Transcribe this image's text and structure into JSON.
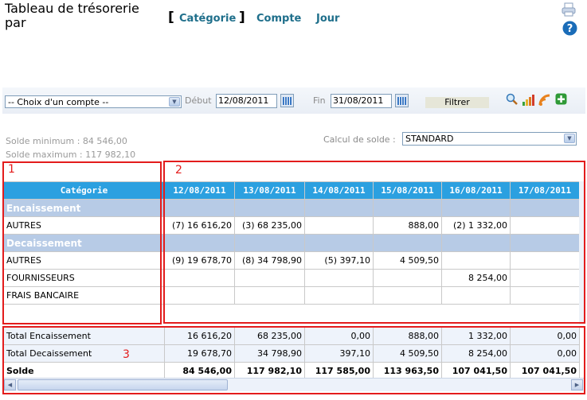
{
  "header": {
    "title_line1": "Tableau de trésorerie",
    "title_line2": "par",
    "bracket_open": "[",
    "bracket_close": "]",
    "nav": [
      "Catégorie",
      "Compte",
      "Jour"
    ]
  },
  "toolbar": {
    "account_select": "-- Choix d'un compte --",
    "debut_label": "Début",
    "debut_value": "12/08/2011",
    "fin_label": "Fin",
    "fin_value": "31/08/2011",
    "filter_label": "Filtrer"
  },
  "summary": {
    "min": "Solde minimum : 84 546,00",
    "max": "Solde maximum : 117 982,10",
    "calc_label": "Calcul de solde :",
    "calc_value": "STANDARD"
  },
  "table": {
    "category_header": "Catégorie",
    "dates": [
      "12/08/2011",
      "13/08/2011",
      "14/08/2011",
      "15/08/2011",
      "16/08/2011",
      "17/08/2011"
    ],
    "rows": [
      {
        "type": "section",
        "label": "Encaissement",
        "cells": [
          "",
          "",
          "",
          "",
          "",
          ""
        ]
      },
      {
        "type": "data",
        "label": "AUTRES",
        "cells": [
          "(7) 16 616,20",
          "(3) 68 235,00",
          "",
          "888,00",
          "(2) 1 332,00",
          ""
        ]
      },
      {
        "type": "section",
        "label": "Decaissement",
        "cells": [
          "",
          "",
          "",
          "",
          "",
          ""
        ]
      },
      {
        "type": "data",
        "label": "AUTRES",
        "cells": [
          "(9) 19 678,70",
          "(8) 34 798,90",
          "(5) 397,10",
          "4 509,50",
          "",
          ""
        ]
      },
      {
        "type": "data",
        "label": "FOURNISSEURS",
        "cells": [
          "",
          "",
          "",
          "",
          "8 254,00",
          ""
        ]
      },
      {
        "type": "data",
        "label": "FRAIS BANCAIRE",
        "cells": [
          "",
          "",
          "",
          "",
          "",
          ""
        ]
      }
    ],
    "totals": [
      {
        "label": "Total Encaissement",
        "cells": [
          "16 616,20",
          "68 235,00",
          "0,00",
          "888,00",
          "1 332,00",
          "0,00"
        ]
      },
      {
        "label": "Total Decaissement",
        "cells": [
          "19 678,70",
          "34 798,90",
          "397,10",
          "4 509,50",
          "8 254,00",
          "0,00"
        ]
      },
      {
        "label": "Solde",
        "cells": [
          "84 546,00",
          "117 982,10",
          "117 585,00",
          "113 963,50",
          "107 041,50",
          "107 041,50"
        ]
      }
    ]
  },
  "annotations": [
    "1",
    "2",
    "3"
  ],
  "colors": {
    "header_blue": "#2ba0e0",
    "section_blue": "#b7cbe6",
    "annotation_red": "#e31c1c",
    "nav_teal": "#1f6f8b"
  }
}
